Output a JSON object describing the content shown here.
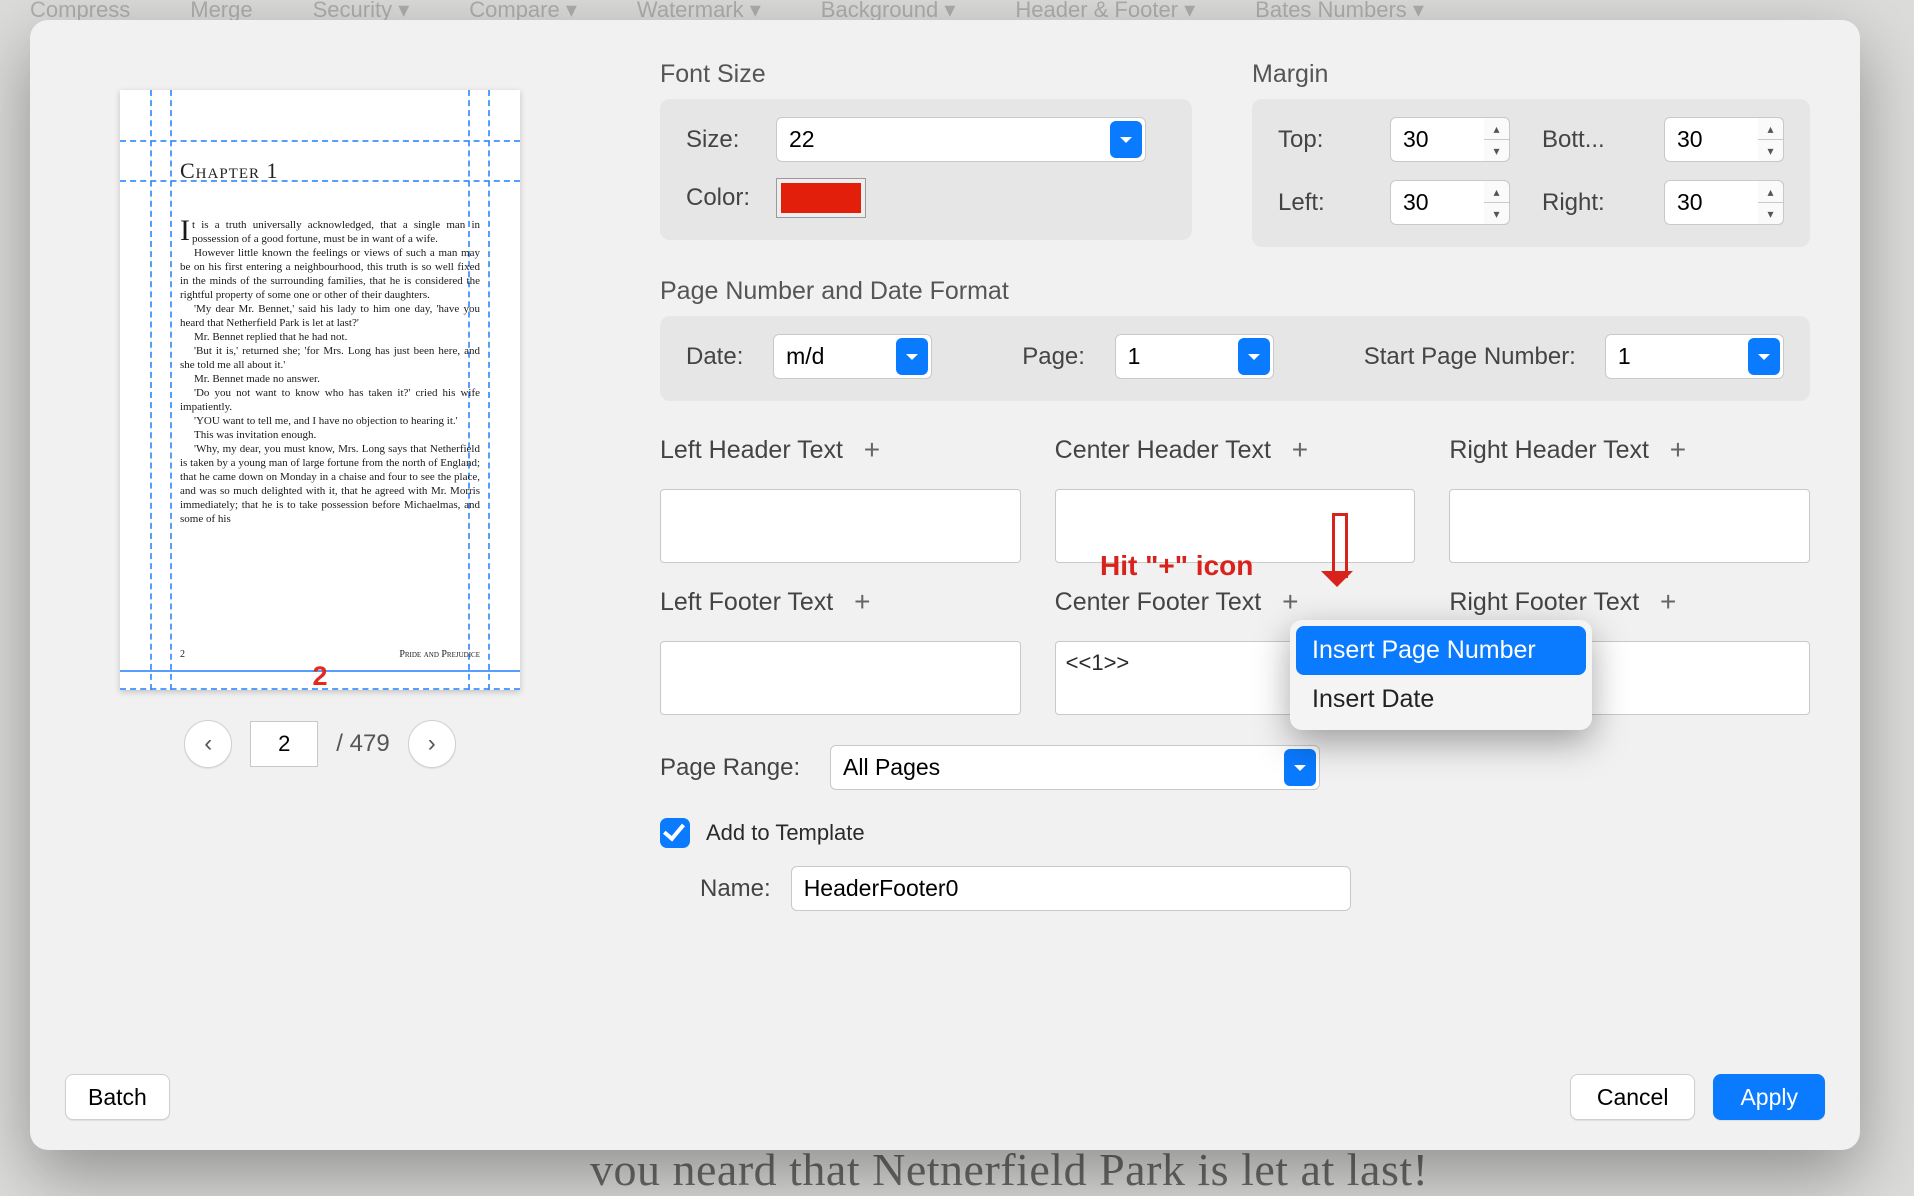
{
  "bg_toolbar": [
    "Compress",
    "Merge",
    "Security ▾",
    "Compare ▾",
    "Watermark ▾",
    "Background ▾",
    "Header & Footer ▾",
    "Bates Numbers ▾"
  ],
  "bg_text": "vou neard that Netnerfield Park is let at last!",
  "preview": {
    "chapter_title": "Chapter 1",
    "body": [
      "t is a truth universally acknowledged, that a single man in possession of a good fortune, must be in want of a wife.",
      "However little known the feelings or views of such a man may be on his first entering a neighbourhood, this truth is so well fixed in the minds of the surrounding families, that he is considered the rightful property of some one or other of their daughters.",
      "'My dear Mr. Bennet,' said his lady to him one day, 'have you heard that Netherfield Park is let at last?'",
      "Mr. Bennet replied that he had not.",
      "'But it is,' returned she; 'for Mrs. Long has just been here, and she told me all about it.'",
      "Mr. Bennet made no answer.",
      "'Do you not want to know who has taken it?' cried his wife impatiently.",
      "'YOU want to tell me, and I have no objection to hearing it.'",
      "This was invitation enough.",
      "'Why, my dear, you must know, Mrs. Long says that Netherfield is taken by a young man of large fortune from the north of England; that he came down on Monday in a chaise and four to see the place, and was so much delighted with it, that he agreed with Mr. Morris immediately; that he is to take possession before Michaelmas, and some of his"
    ],
    "foot_left": "2",
    "foot_right": "Pride and Prejudice",
    "big_page_number": "2"
  },
  "pager": {
    "current": "2",
    "total": "/ 479"
  },
  "font": {
    "section": "Font Size",
    "size_label": "Size:",
    "size_value": "22",
    "color_label": "Color:",
    "color_hex": "#e21f0b"
  },
  "margin": {
    "section": "Margin",
    "top_label": "Top:",
    "top": "30",
    "bottom_label": "Bott...",
    "bottom": "30",
    "left_label": "Left:",
    "left": "30",
    "right_label": "Right:",
    "right": "30"
  },
  "pn": {
    "section": "Page Number and Date Format",
    "date_label": "Date:",
    "date_value": "m/d",
    "page_label": "Page:",
    "page_value": "1",
    "start_label": "Start Page Number:",
    "start_value": "1"
  },
  "hf": {
    "lh": "Left Header Text",
    "ch": "Center Header Text",
    "rh": "Right Header Text",
    "lf": "Left Footer Text",
    "cf": "Center Footer Text",
    "rf": "Right Footer Text",
    "cf_value": "<<1>>"
  },
  "annotation": {
    "text": "Hit \"+\" icon"
  },
  "popup": {
    "item1": "Insert Page Number",
    "item2": "Insert Date"
  },
  "page_range": {
    "label": "Page Range:",
    "value": "All Pages"
  },
  "template": {
    "checkbox_label": "Add to Template",
    "name_label": "Name:",
    "name_value": "HeaderFooter0"
  },
  "buttons": {
    "batch": "Batch",
    "cancel": "Cancel",
    "apply": "Apply"
  }
}
